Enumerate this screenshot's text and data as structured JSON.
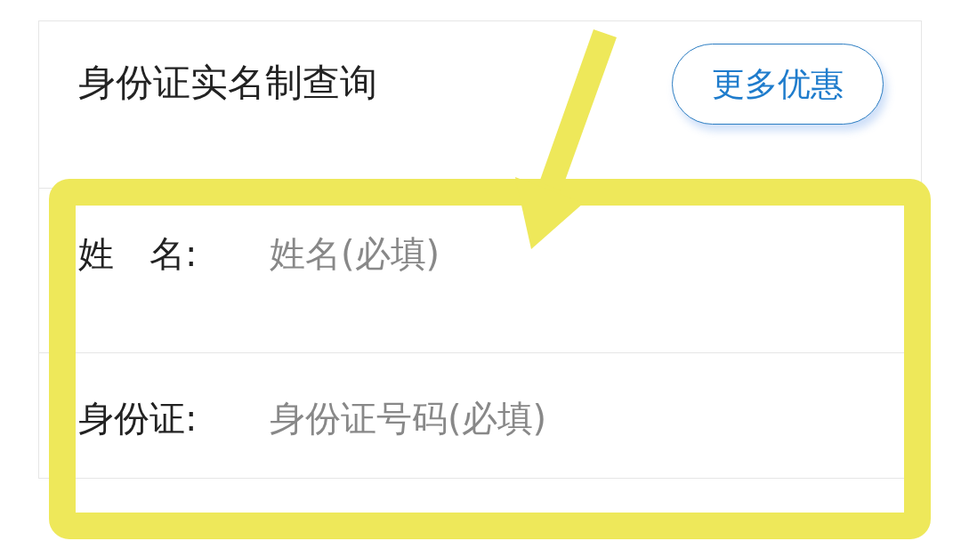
{
  "header": {
    "title": "身份证实名制查询",
    "more_button": "更多优惠"
  },
  "fields": [
    {
      "label": "姓　名:",
      "placeholder": "姓名(必填)"
    },
    {
      "label": "身份证:",
      "placeholder": "身份证号码(必填)"
    }
  ]
}
